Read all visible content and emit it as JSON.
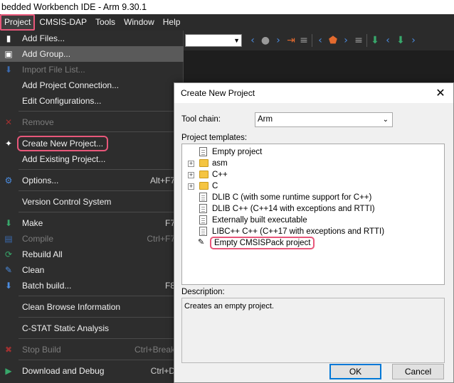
{
  "window": {
    "title": "bedded Workbench IDE - Arm 9.30.1"
  },
  "menubar": [
    "Project",
    "CMSIS-DAP",
    "Tools",
    "Window",
    "Help"
  ],
  "project_menu": [
    {
      "label": "Add Files...",
      "shortcut": "",
      "disabled": false,
      "icon": "add-files-icon"
    },
    {
      "label": "Add Group...",
      "shortcut": "",
      "disabled": false,
      "highlight": true,
      "icon": "add-group-icon"
    },
    {
      "label": "Import File List...",
      "shortcut": "",
      "disabled": true,
      "icon": "import-icon"
    },
    {
      "label": "Add Project Connection...",
      "shortcut": "",
      "disabled": false
    },
    {
      "label": "Edit Configurations...",
      "shortcut": "",
      "disabled": false
    },
    {
      "label": "Remove",
      "shortcut": "",
      "disabled": true,
      "icon": "remove-icon"
    },
    {
      "label": "Create New Project...",
      "shortcut": "",
      "disabled": false,
      "boxed": true,
      "icon": "new-project-icon"
    },
    {
      "label": "Add Existing Project...",
      "shortcut": "",
      "disabled": false
    },
    {
      "label": "Options...",
      "shortcut": "Alt+F7",
      "disabled": false,
      "icon": "gear-icon"
    },
    {
      "label": "Version Control System",
      "shortcut": "",
      "disabled": false
    },
    {
      "label": "Make",
      "shortcut": "F7",
      "disabled": false,
      "icon": "make-icon"
    },
    {
      "label": "Compile",
      "shortcut": "Ctrl+F7",
      "disabled": true,
      "icon": "compile-icon"
    },
    {
      "label": "Rebuild All",
      "shortcut": "",
      "disabled": false,
      "icon": "rebuild-icon"
    },
    {
      "label": "Clean",
      "shortcut": "",
      "disabled": false,
      "icon": "clean-icon"
    },
    {
      "label": "Batch build...",
      "shortcut": "F8",
      "disabled": false,
      "icon": "batch-icon"
    },
    {
      "label": "Clean Browse Information",
      "shortcut": "",
      "disabled": false
    },
    {
      "label": "C-STAT Static Analysis",
      "shortcut": "",
      "disabled": false
    },
    {
      "label": "Stop Build",
      "shortcut": "Ctrl+Break",
      "disabled": true,
      "icon": "stop-icon"
    },
    {
      "label": "Download and Debug",
      "shortcut": "Ctrl+D",
      "disabled": false,
      "icon": "play-icon"
    }
  ],
  "dialog": {
    "title": "Create New Project",
    "toolchain_label": "Tool chain:",
    "toolchain_value": "Arm",
    "templates_label": "Project templates:",
    "templates": [
      {
        "label": "Empty project",
        "type": "doc",
        "expandable": false
      },
      {
        "label": "asm",
        "type": "folder",
        "expandable": true
      },
      {
        "label": "C++",
        "type": "folder",
        "expandable": true
      },
      {
        "label": "C",
        "type": "folder",
        "expandable": true
      },
      {
        "label": "DLIB C (with some runtime support for C++)",
        "type": "doc",
        "expandable": false
      },
      {
        "label": "DLIB C++ (C++14 with exceptions and RTTI)",
        "type": "doc",
        "expandable": false
      },
      {
        "label": "Externally built executable",
        "type": "doc",
        "expandable": false
      },
      {
        "label": "LIBC++ C++ (C++17 with exceptions and RTTI)",
        "type": "doc",
        "expandable": false
      },
      {
        "label": "Empty CMSISPack project",
        "type": "pen",
        "expandable": false,
        "boxed": true
      }
    ],
    "description_label": "Description:",
    "description": "Creates an empty project.",
    "ok": "OK",
    "cancel": "Cancel"
  },
  "colors": {
    "highlight_box": "#e8577a",
    "menu_bg": "#2d2d2d",
    "dialog_bg": "#f0f0f0"
  }
}
